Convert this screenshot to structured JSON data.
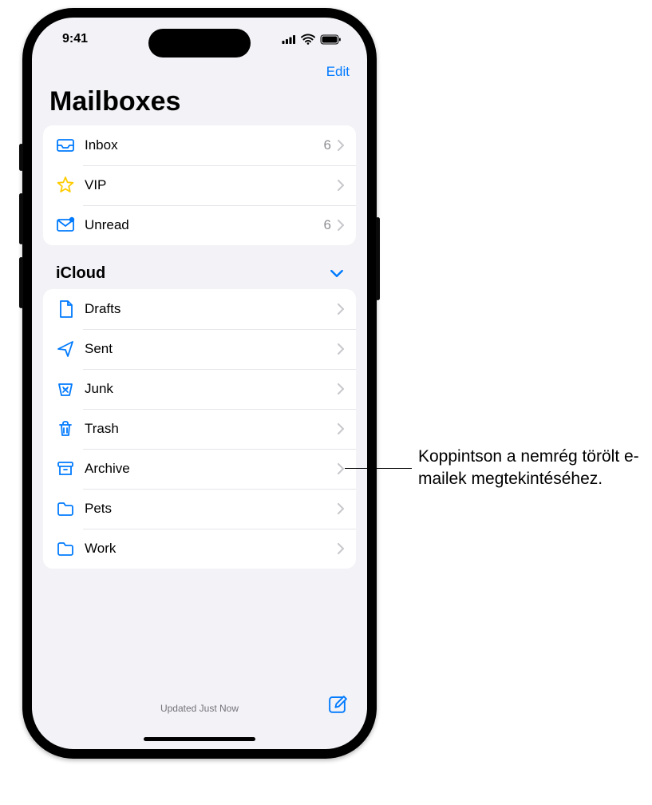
{
  "status": {
    "time": "9:41"
  },
  "nav": {
    "edit": "Edit"
  },
  "page": {
    "title": "Mailboxes"
  },
  "smart": [
    {
      "icon": "inbox-icon",
      "label": "Inbox",
      "count": "6"
    },
    {
      "icon": "star-icon",
      "label": "VIP",
      "count": ""
    },
    {
      "icon": "unread-icon",
      "label": "Unread",
      "count": "6"
    }
  ],
  "section": {
    "title": "iCloud"
  },
  "icloud": [
    {
      "icon": "drafts-icon",
      "label": "Drafts"
    },
    {
      "icon": "sent-icon",
      "label": "Sent"
    },
    {
      "icon": "junk-icon",
      "label": "Junk"
    },
    {
      "icon": "trash-icon",
      "label": "Trash"
    },
    {
      "icon": "archive-icon",
      "label": "Archive"
    },
    {
      "icon": "folder-icon",
      "label": "Pets"
    },
    {
      "icon": "folder-icon",
      "label": "Work"
    }
  ],
  "toolbar": {
    "status": "Updated Just Now"
  },
  "callout": {
    "text": "Koppintson a nemrég törölt e-mailek megtekintéséhez."
  }
}
